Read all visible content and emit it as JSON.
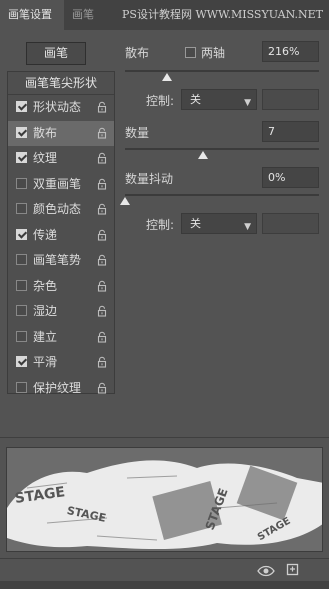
{
  "tabs": [
    {
      "label": "画笔设置"
    },
    {
      "label": "画笔"
    }
  ],
  "watermark": "PS设计教程网 WWW.MISSYUAN.NET",
  "left": {
    "preset_button": "画笔",
    "tip_shape_header": "画笔笔尖形状",
    "options": [
      {
        "label": "形状动态",
        "checked": true,
        "selected": false
      },
      {
        "label": "散布",
        "checked": true,
        "selected": true
      },
      {
        "label": "纹理",
        "checked": true,
        "selected": false
      },
      {
        "label": "双重画笔",
        "checked": false,
        "selected": false
      },
      {
        "label": "颜色动态",
        "checked": false,
        "selected": false
      },
      {
        "label": "传递",
        "checked": true,
        "selected": false
      },
      {
        "label": "画笔笔势",
        "checked": false,
        "selected": false
      },
      {
        "label": "杂色",
        "checked": false,
        "selected": false
      },
      {
        "label": "湿边",
        "checked": false,
        "selected": false
      },
      {
        "label": "建立",
        "checked": false,
        "selected": false
      },
      {
        "label": "平滑",
        "checked": true,
        "selected": false
      },
      {
        "label": "保护纹理",
        "checked": false,
        "selected": false
      }
    ]
  },
  "scatter": {
    "label": "散布",
    "both_axes_label": "两轴",
    "both_axes_checked": false,
    "value": "216%",
    "level_percent": 216,
    "control_label": "控制:",
    "control_value": "关"
  },
  "count": {
    "label": "数量",
    "value": "7",
    "level": 7
  },
  "count_jitter": {
    "label": "数量抖动",
    "value": "0%",
    "level_percent": 0,
    "control_label": "控制:",
    "control_value": "关"
  },
  "preview_text": [
    "STAGE",
    "STAGE",
    "STAGE",
    "STAGE"
  ]
}
